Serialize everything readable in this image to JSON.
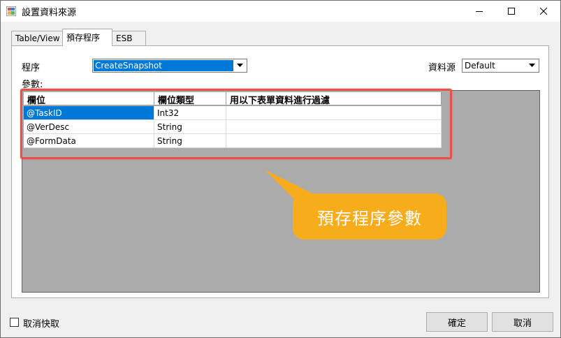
{
  "window": {
    "title": "設置資料來源"
  },
  "tabs": [
    {
      "label": "Table/View"
    },
    {
      "label": "預存程序"
    },
    {
      "label": "ESB"
    }
  ],
  "form": {
    "procedure_label": "程序",
    "procedure_value": "CreateSnapshot",
    "datasource_label": "資料源",
    "datasource_value": "Default",
    "params_label": "參數:"
  },
  "grid": {
    "columns": [
      "欄位",
      "欄位類型",
      "用以下表單資料進行過濾"
    ],
    "rows": [
      {
        "field": "@TaskID",
        "type": "Int32",
        "filter": ""
      },
      {
        "field": "@VerDesc",
        "type": "String",
        "filter": ""
      },
      {
        "field": "@FormData",
        "type": "String",
        "filter": ""
      }
    ]
  },
  "callout": {
    "text": "預存程序參數"
  },
  "footer": {
    "nocache_label": "取消快取",
    "ok_label": "確定",
    "cancel_label": "取消"
  },
  "colors": {
    "selection": "#0078d7",
    "highlight_border": "#e8504a",
    "callout": "#f6ac1b"
  }
}
